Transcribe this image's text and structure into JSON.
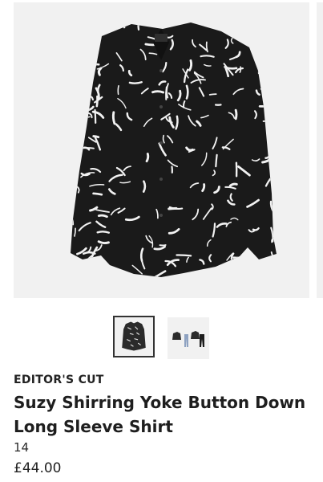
{
  "product": {
    "brand": "EDITOR'S CUT",
    "title": "Suzy Shirring Yoke Button Down Long Sleeve Shirt",
    "size": "14",
    "price": "£44.00"
  },
  "gallery": {
    "images": [
      {
        "name": "product-image-shirt",
        "selected": true
      },
      {
        "name": "product-image-outfit",
        "selected": false
      }
    ]
  },
  "colors": {
    "background": "#ffffff",
    "image_background": "#f1f1f1",
    "shirt": "#1a1a1a",
    "print": "#f2f2f2",
    "text": "#1f1f1f"
  }
}
